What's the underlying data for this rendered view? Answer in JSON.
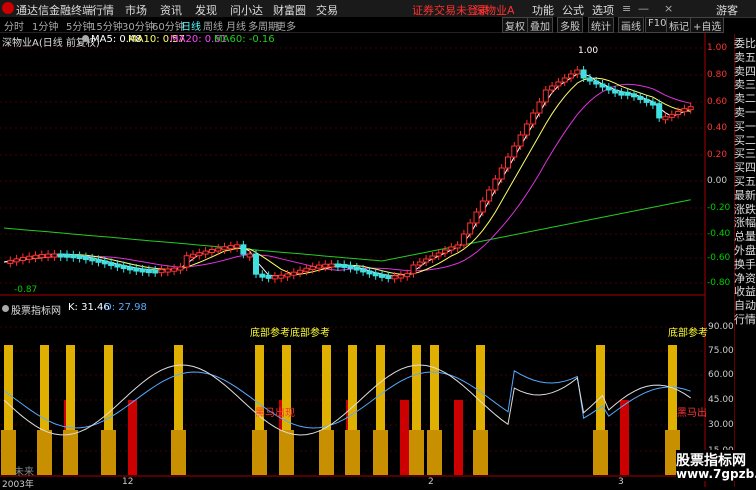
{
  "titlebar": {
    "app_name": "通达信金融终端",
    "menus": [
      "行情",
      "市场",
      "资讯",
      "发现",
      "问小达",
      "财富圈",
      "交易"
    ],
    "ticker_status": "证券交易未登录",
    "ticker_name": "深物业A",
    "right_menus": [
      "功能",
      "公式",
      "选项"
    ],
    "guest": "游客"
  },
  "periodbar": {
    "periods": [
      "分时",
      "1分钟",
      "5分钟",
      "15分钟",
      "30分钟",
      "60分钟",
      "日线",
      "周线",
      "月线",
      "多周期",
      "更多"
    ],
    "active": "日线",
    "tools": [
      "复权",
      "叠加",
      "多股",
      "统计",
      "画线",
      "F10",
      "标记",
      "+自选"
    ]
  },
  "infoline": {
    "title": "深物业A(日线 前复权)",
    "ma5": "MA5: 0.48",
    "ma10": "MA10: 0.57",
    "ma20": "MA20: 0.61",
    "ma60": "MA60: -0.16"
  },
  "price_axis": {
    "labels": [
      "1.00",
      "0.80",
      "0.60",
      "0.40",
      "0.20",
      "0.00",
      "-0.20",
      "-0.40",
      "-0.60",
      "-0.80"
    ],
    "high_mark": "1.00",
    "low_mark": "-0.87"
  },
  "indicator": {
    "name": "股票指标网",
    "k": "K: 31.46",
    "d": "D: 27.98",
    "axis_labels": [
      "90.00",
      "75.00",
      "60.00",
      "45.00",
      "30.00",
      "15.00"
    ],
    "signal_bottom": "底部参考",
    "signal_bottom_double": "底部参考底部参考",
    "signal_horse": "黑马出现",
    "signal_horse_short": "黑马出"
  },
  "x_axis": {
    "labels": [
      "2003年",
      "12",
      "2",
      "3"
    ],
    "future": "未来"
  },
  "right_column": [
    "委比",
    "卖五",
    "卖四",
    "卖三",
    "卖二",
    "卖一",
    "买一",
    "买二",
    "买三",
    "买四",
    "买五",
    "最新",
    "涨跌",
    "涨幅",
    "总量",
    "外盘",
    "换手",
    "净资",
    "收益",
    "自动",
    "行情"
  ],
  "watermark": {
    "line1": "股票指标网",
    "line2": "www.7gpzb.com"
  },
  "colors": {
    "up": "#ff3030",
    "down": "#40e0e0",
    "ma5": "#ffffff",
    "ma10": "#ffff66",
    "ma20": "#ff44ff",
    "ma60": "#22cc22",
    "k_line": "#ffffff",
    "d_line": "#55aaff"
  }
}
